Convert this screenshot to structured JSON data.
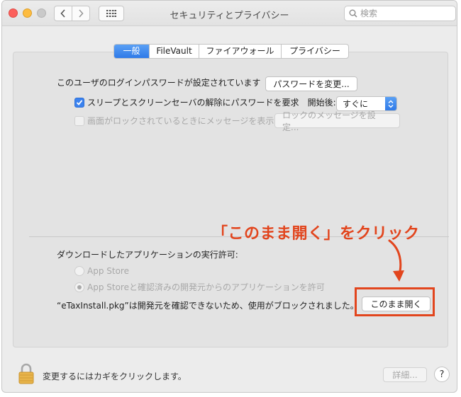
{
  "window": {
    "title": "セキュリティとプライバシー",
    "search_placeholder": "検索"
  },
  "tabs": [
    {
      "label": "一般",
      "active": true
    },
    {
      "label": "FileVault",
      "active": false
    },
    {
      "label": "ファイアウォール",
      "active": false
    },
    {
      "label": "プライバシー",
      "active": false
    }
  ],
  "general": {
    "login_password_label": "このユーザのログインパスワードが設定されています",
    "change_password_button": "パスワードを変更...",
    "require_password_label": "スリープとスクリーンセーバの解除にパスワードを要求",
    "require_password_checked": true,
    "start_after_label": "開始後:",
    "start_after_value": "すぐに",
    "lock_message_label": "画面がロックされているときにメッセージを表示",
    "lock_message_checked": false,
    "lock_message_button": "ロックのメッセージを設定..."
  },
  "downloads": {
    "heading": "ダウンロードしたアプリケーションの実行許可:",
    "option_app_store": "App Store",
    "option_identified": "App Storeと確認済みの開発元からのアプリケーションを許可",
    "blocked_message": "“eTaxInstall.pkg”は開発元を確認できないため、使用がブロックされました。",
    "open_anyway_button": "このまま開く"
  },
  "annotation": {
    "text": "「このまま開く」をクリック",
    "color": "#e2451d"
  },
  "footer": {
    "lock_text": "変更するにはカギをクリックします。",
    "details_button": "詳細...",
    "help_button": "?"
  },
  "colors": {
    "accent": "#3b82ee",
    "annotation": "#e2451d"
  }
}
